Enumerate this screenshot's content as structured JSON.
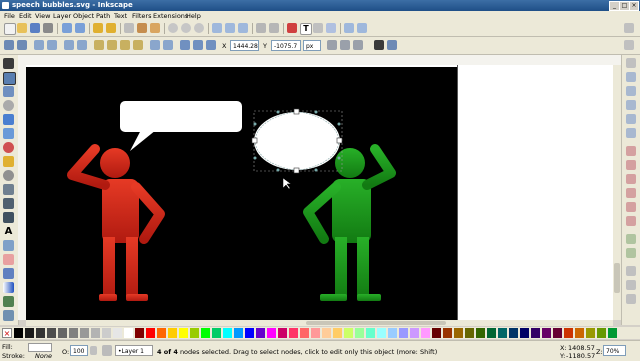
{
  "window": {
    "title": "speech bubbles.svg - Inkscape"
  },
  "menu": [
    "File",
    "Edit",
    "View",
    "Layer",
    "Object",
    "Path",
    "Text",
    "Filters",
    "Extensions",
    "Help"
  ],
  "toolbar": {
    "x_label": "X",
    "x_value": "1444.28",
    "y_label": "Y",
    "y_value": "-1075.7",
    "unit": "px"
  },
  "status": {
    "fill_label": "Fill:",
    "stroke_label": "Stroke:",
    "stroke_value": "None",
    "opacity_label": "O:",
    "opacity_value": "100",
    "layer": "•Layer 1",
    "message_bold": "4 of 4",
    "message": " nodes selected. Drag to select nodes, click to edit only this object (more: Shift)",
    "x_coord_label": "X:",
    "x_coord": "1408.57",
    "y_coord_label": "Y:",
    "y_coord": "-1180.57",
    "zoom_label": "Z:",
    "zoom": "70%"
  },
  "colors": {
    "red_figure": "#d42a1c",
    "green_figure": "#1e9a1e",
    "page_background": "#000000"
  },
  "palette": [
    "#000000",
    "#1a1a1a",
    "#333333",
    "#4d4d4d",
    "#666666",
    "#808080",
    "#999999",
    "#b3b3b3",
    "#cccccc",
    "#e6e6e6",
    "#ffffff",
    "#800000",
    "#ff0000",
    "#ff6600",
    "#ffcc00",
    "#ffff00",
    "#99cc00",
    "#00ff00",
    "#00cc66",
    "#00ffff",
    "#0099ff",
    "#0000ff",
    "#6600cc",
    "#ff00ff",
    "#cc0066",
    "#ff3366",
    "#ff6666",
    "#ff9999",
    "#ffcc99",
    "#ffcc66",
    "#ccff66",
    "#99ff99",
    "#66ffcc",
    "#99ffff",
    "#99ccff",
    "#9999ff",
    "#cc99ff",
    "#ff99ff",
    "#660000",
    "#993300",
    "#996600",
    "#666600",
    "#336600",
    "#006633",
    "#006666",
    "#003366",
    "#000066",
    "#330066",
    "#660066",
    "#660033",
    "#cc3300",
    "#cc6600",
    "#999900",
    "#669900",
    "#009933"
  ],
  "icons": {
    "tools": [
      "selector-icon",
      "node-icon",
      "tweak-icon",
      "zoom-icon",
      "rect-icon",
      "3dbox-icon",
      "ellipse-icon",
      "star-icon",
      "spiral-icon",
      "pencil-icon",
      "pen-icon",
      "calligraphy-icon",
      "text-icon",
      "spray-icon",
      "eraser-icon",
      "bucket-icon",
      "gradient-icon",
      "dropper-icon",
      "connector-icon"
    ]
  }
}
